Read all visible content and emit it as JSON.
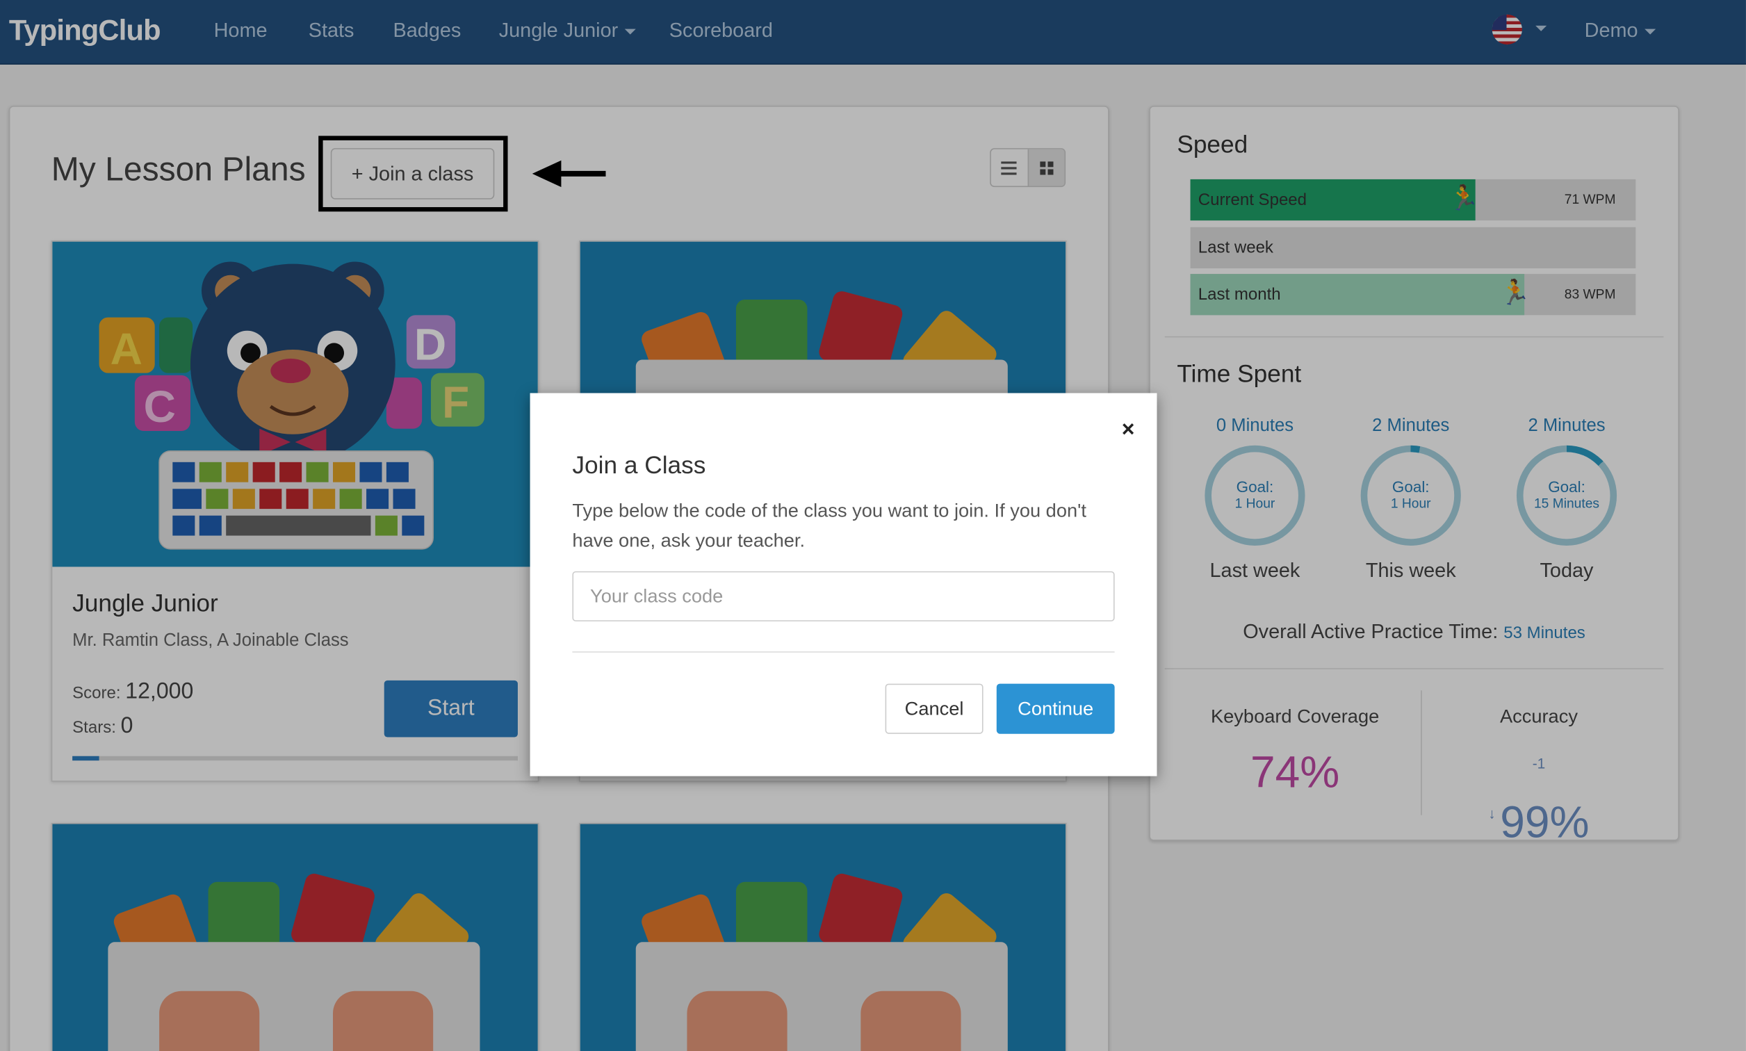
{
  "navbar": {
    "brand": "TypingClub",
    "links": [
      "Home",
      "Stats",
      "Badges",
      "Jungle Junior",
      "Scoreboard"
    ],
    "user": "Demo",
    "flag_icon": "us-flag-icon"
  },
  "lesson_plans": {
    "title": "My Lesson Plans",
    "join_label": "+ Join a class",
    "card": {
      "title": "Jungle Junior",
      "subtitle": "Mr. Ramtin Class, A Joinable Class",
      "score_label": "Score:",
      "score": "12,000",
      "stars_label": "Stars:",
      "stars": "0",
      "start_label": "Start",
      "progress": 0.06
    }
  },
  "speed": {
    "title": "Speed",
    "bars": [
      {
        "label": "Current Speed",
        "value": "71 WPM",
        "fill": 0.64,
        "color": "#1fa36a"
      },
      {
        "label": "Last week",
        "value": "",
        "fill": 0,
        "color": "#e0e0e0"
      },
      {
        "label": "Last month",
        "value": "83 WPM",
        "fill": 0.75,
        "color": "#9fd9bd"
      }
    ]
  },
  "time_spent": {
    "title": "Time Spent",
    "columns": [
      {
        "minutes": "0 Minutes",
        "goal": "Goal:",
        "goal_value": "1 Hour",
        "caption": "Last week",
        "progress": 0.0
      },
      {
        "minutes": "2 Minutes",
        "goal": "Goal:",
        "goal_value": "1 Hour",
        "caption": "This week",
        "progress": 0.03
      },
      {
        "minutes": "2 Minutes",
        "goal": "Goal:",
        "goal_value": "15 Minutes",
        "caption": "Today",
        "progress": 0.13
      }
    ],
    "overall_label": "Overall Active Practice Time:",
    "overall_value": "53 Minutes"
  },
  "keyboard_coverage": {
    "label": "Keyboard Coverage",
    "value": "74%",
    "color": "#c04aa5"
  },
  "accuracy": {
    "label": "Accuracy",
    "value": "99%",
    "delta": "-1",
    "color": "#6b8fc4"
  },
  "modal": {
    "title": "Join a Class",
    "body": "Type below the code of the class you want to join. If you don't have one, ask your teacher.",
    "placeholder": "Your class code",
    "cancel": "Cancel",
    "continue": "Continue",
    "close_glyph": "×"
  }
}
